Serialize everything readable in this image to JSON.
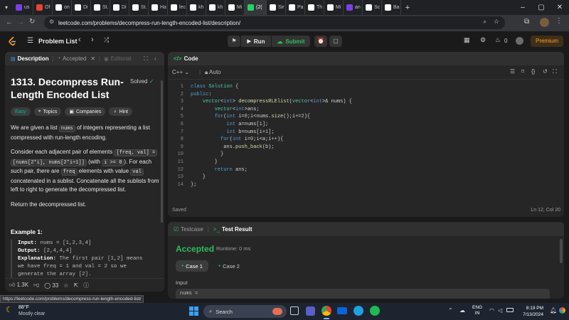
{
  "browser": {
    "tabs": [
      {
        "label": "us",
        "color": "#7b3fe4"
      },
      {
        "label": "Of",
        "color": "#ea4335"
      },
      {
        "label": "on",
        "color": "#ffffff"
      },
      {
        "label": "Di",
        "color": "#ffffff"
      },
      {
        "label": "St.",
        "color": "#ffffff"
      },
      {
        "label": "Di",
        "color": "#ffffff"
      },
      {
        "label": "St.",
        "color": "#ffffff"
      },
      {
        "label": "Ha",
        "color": "#ffffff"
      },
      {
        "label": "lec",
        "color": "#ffffff"
      },
      {
        "label": "kh",
        "color": "#ffffff"
      },
      {
        "label": "kh",
        "color": "#ffffff"
      },
      {
        "label": "Mi",
        "color": "#ffffff"
      },
      {
        "label": "(2(",
        "color": "#25d366"
      },
      {
        "label": "Sir",
        "color": "#ffffff"
      },
      {
        "label": "Pa",
        "color": "#ffffff"
      },
      {
        "label": "Th",
        "color": "#ffffff"
      },
      {
        "label": "Mi",
        "color": "#ffffff"
      },
      {
        "label": "an",
        "color": "#7b3fe4"
      },
      {
        "label": "Sc",
        "color": "#ffffff"
      },
      {
        "label": "Ba",
        "color": "#ffffff"
      }
    ],
    "new_tab": "+",
    "url": "leetcode.com/problems/decompress-run-length-encoded-list/description/",
    "status_url": "https://leetcode.com/problems/decompress-run-length-encoded-list/"
  },
  "header": {
    "problem_list": "Problem List",
    "run": "Run",
    "submit": "Submit",
    "streak": "0",
    "premium": "Premium"
  },
  "left": {
    "tabs": {
      "description": "Description",
      "accepted": "Accepted",
      "editorial": "Editorial"
    },
    "title": "1313. Decompress Run-Length Encoded List",
    "title_line1": "1313. Decompress Run-",
    "title_line2": "Length Encoded List",
    "solved": "Solved",
    "tags": {
      "difficulty": "Easy",
      "topics": "Topics",
      "companies": "Companies",
      "hint": "Hint"
    },
    "para1_a": "We are given a list",
    "para1_code": "nums",
    "para1_b": "of integers representing a list",
    "para1_c": "compressed with run-length encoding.",
    "para2_a": "Consider each adjacent pair of elements",
    "para2_code1": "[freq, val] =",
    "para2_code2": "[nums[2*i], nums[2*i+1]]",
    "para2_b": "(with",
    "para2_code3": "i >= 0",
    "para2_c": "). For each",
    "para2_d": "such pair, there are",
    "para2_code4": "freq",
    "para2_e": "elements with value",
    "para2_code5": "val",
    "para2_f": "concatenated in a sublist. Concatenate all the sublists",
    "para2_g": "from left to right to generate the decompressed list.",
    "para3": "Return the decompressed list.",
    "example_title": "Example 1:",
    "ex_input_label": "Input:",
    "ex_input_value": "nums = [1,2,3,4]",
    "ex_output_label": "Output:",
    "ex_output_value": "[2,4,4,4]",
    "ex_expl_label": "Explanation:",
    "ex_expl_value1": "The first pair [1,2] means",
    "ex_expl_value2": "we have freq = 1 and val = 2 so we",
    "ex_expl_value3": "generate the array [2].",
    "likes": "1.3K",
    "comments": "33"
  },
  "code": {
    "header": "Code",
    "language": "C++",
    "mode": "Auto",
    "status": "Saved",
    "cursor": "Ln 12, Col 20",
    "lines": [
      "class Solution {",
      "public:",
      "    vector<int> decompressRLElist(vector<int>& nums) {",
      "        vector<int>ans;",
      "        for(int i=0;i<nums.size();i+=2){",
      "            int a=nums[i];",
      "            int b=nums[i+1];",
      "          for(int i=0;i<a;i++){",
      "           ans.push_back(b);",
      "          }",
      "        }",
      "        return ans;",
      "    }",
      "};"
    ],
    "line_numbers": [
      "1",
      "2",
      "3",
      "4",
      "5",
      "6",
      "7",
      "8",
      "9",
      "10",
      "11",
      "12",
      "13",
      "14"
    ]
  },
  "result": {
    "tab_testcase": "Testcase",
    "tab_result": "Test Result",
    "status": "Accepted",
    "runtime": "Runtime: 0 ms",
    "case1": "Case 1",
    "case2": "Case 2",
    "input_label": "Input",
    "input_preview": "nums ="
  },
  "taskbar": {
    "weather_temp": "88°F",
    "weather_desc": "Mostly clear",
    "search_placeholder": "Search",
    "lang_line1": "ENG",
    "lang_line2": "IN",
    "time": "8:19 PM",
    "date": "7/13/2024"
  },
  "colors": {
    "accent_green": "#2cbb5d",
    "easy": "#00b8a3",
    "premium": "#ffa116"
  }
}
